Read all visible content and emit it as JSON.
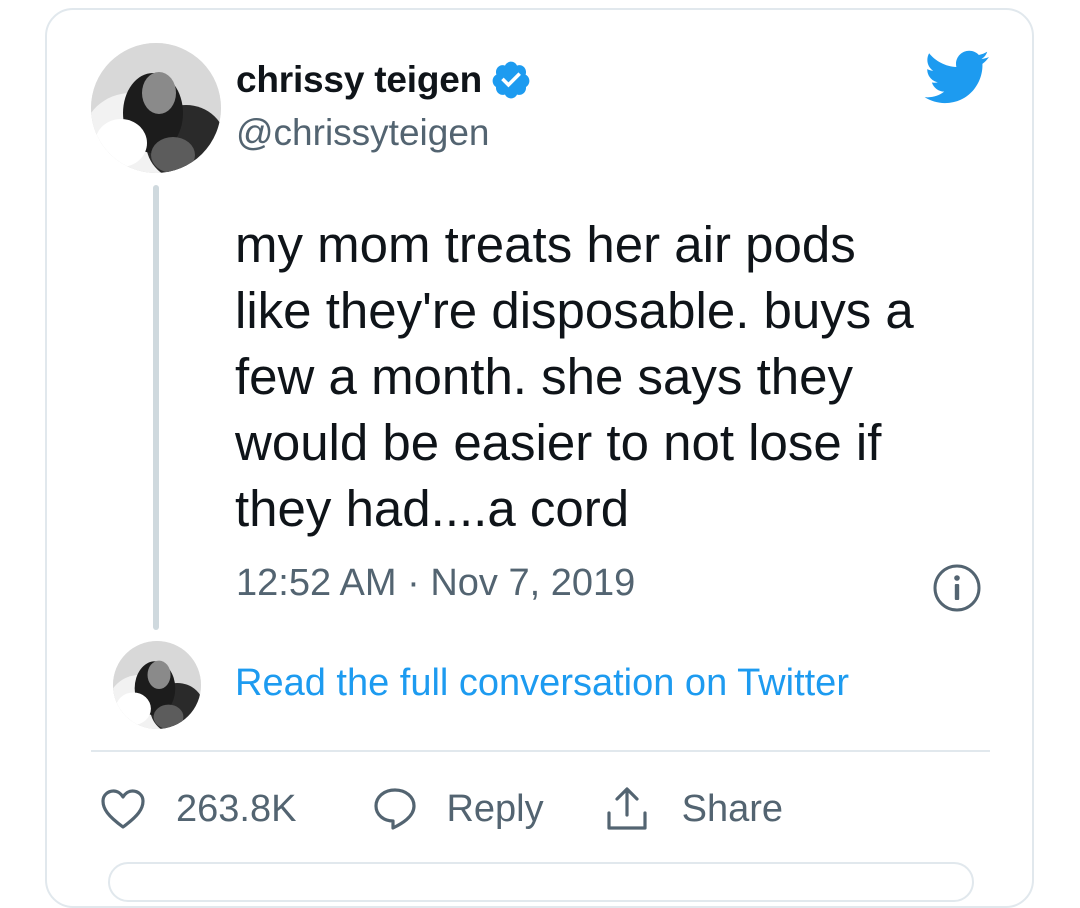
{
  "tweet": {
    "author": {
      "display_name": "chrissy teigen",
      "handle": "@chrissyteigen",
      "verified": true
    },
    "text_lines": [
      "my mom treats her air pods",
      "like they're disposable. buys a",
      "few a month. she says they",
      "would be easier to not lose if",
      "they had....a cord"
    ],
    "timestamp": "12:52 AM · Nov 7, 2019",
    "read_more_link": "Read the full conversation on Twitter",
    "actions": {
      "like_count": "263.8K",
      "reply_label": "Reply",
      "share_label": "Share"
    }
  },
  "icons": {
    "brand": "twitter-bird-icon",
    "verified": "verified-badge-icon",
    "info": "info-icon",
    "like": "heart-icon",
    "reply": "speech-bubble-icon",
    "share": "share-upload-icon"
  },
  "colors": {
    "twitter_blue": "#1d9bf0",
    "text_primary": "#0f1419",
    "text_secondary": "#536471",
    "border": "#e1e8ed",
    "thread_line": "#cfd9de"
  }
}
